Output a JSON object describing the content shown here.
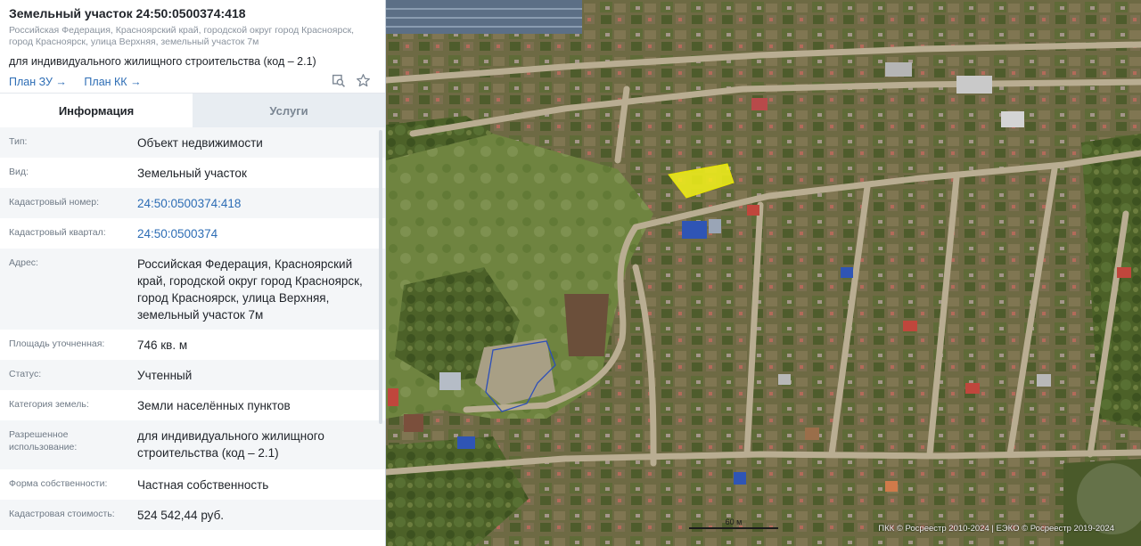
{
  "header": {
    "title": "Земельный участок 24:50:0500374:418",
    "address": "Российская Федерация, Красноярский край, городской округ город Красноярск, город Красноярск, улица Верхняя, земельный участок 7м",
    "purpose": "для индивидуального жилищного строительства (код – 2.1)",
    "link_plan_zu": "План ЗУ →",
    "link_plan_kk": "План КК →"
  },
  "icons": {
    "search": "search-icon",
    "star": "star-icon"
  },
  "tabs": [
    {
      "label": "Информация",
      "active": true
    },
    {
      "label": "Услуги",
      "active": false
    }
  ],
  "rows": [
    {
      "key": "Тип:",
      "value": "Объект недвижимости"
    },
    {
      "key": "Вид:",
      "value": "Земельный участок"
    },
    {
      "key": "Кадастровый номер:",
      "value": "24:50:0500374:418"
    },
    {
      "key": "Кадастровый квартал:",
      "value": "24:50:0500374"
    },
    {
      "key": "Адрес:",
      "value": "Российская Федерация, Красноярский край, городской округ город Красноярск, город Красноярск, улица Верхняя, земельный участок 7м"
    },
    {
      "key": "Площадь уточненная:",
      "value": "746 кв. м"
    },
    {
      "key": "Статус:",
      "value": "Учтенный"
    },
    {
      "key": "Категория земель:",
      "value": "Земли населённых пунктов"
    },
    {
      "key": "Разрешенное использование:",
      "value": "для индивидуального жилищного строительства (код – 2.1)"
    },
    {
      "key": "Форма собственности:",
      "value": "Частная собственность"
    },
    {
      "key": "Кадастровая стоимость:",
      "value": "524 542,44 руб."
    }
  ],
  "map": {
    "scale_label": "60 м",
    "copyright": "ПКК © Росреестр 2010-2024 | ЕЭКО © Росреестр 2019-2024",
    "colors": {
      "highlight_fill": "#f5f21a",
      "parcel_outline": "#2d4fb8",
      "road": "#b9ad92",
      "vegetation": "#5b6e33"
    }
  }
}
